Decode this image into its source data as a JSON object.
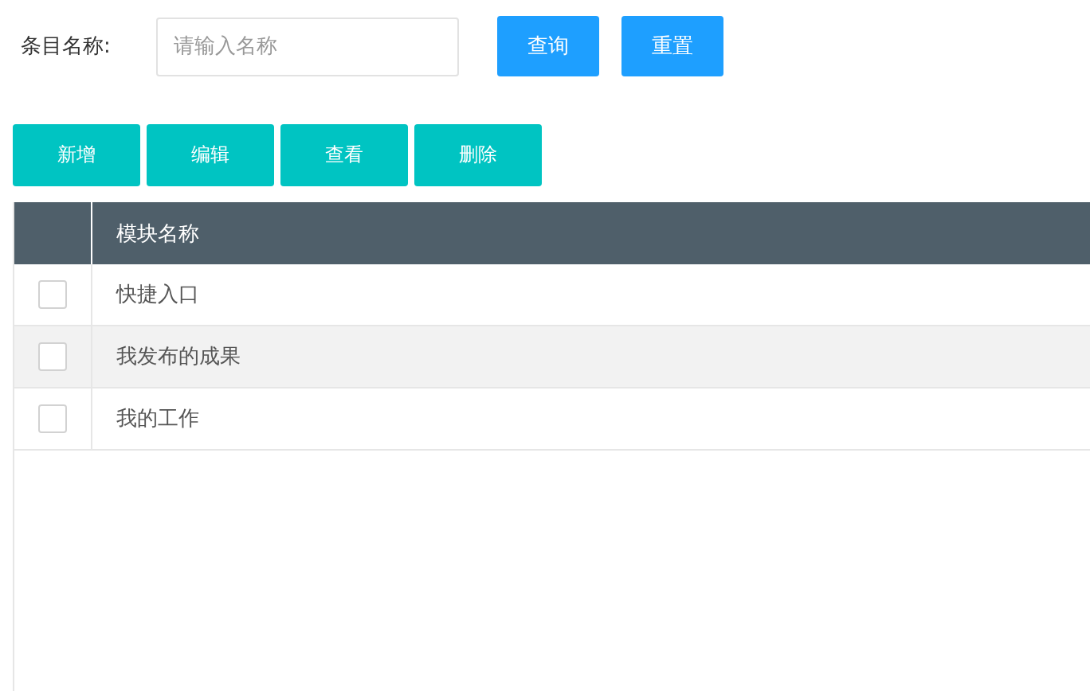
{
  "search": {
    "label": "条目名称:",
    "placeholder": "请输入名称",
    "buttons": [
      "查询",
      "重置"
    ]
  },
  "actions": [
    "新增",
    "编辑",
    "查看",
    "删除"
  ],
  "table": {
    "columns": [
      "模块名称"
    ],
    "rows": [
      {
        "name": "快捷入口",
        "checked": false
      },
      {
        "name": "我发布的成果",
        "checked": false
      },
      {
        "name": "我的工作",
        "checked": false
      }
    ]
  }
}
